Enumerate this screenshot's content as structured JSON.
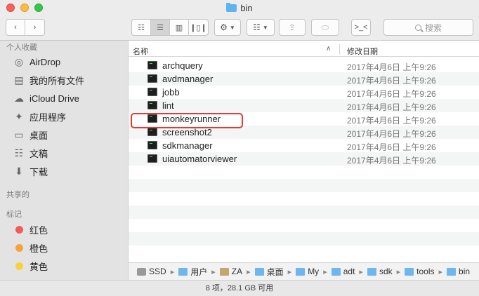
{
  "window": {
    "title": "bin"
  },
  "toolbar": {
    "back_icon": "chevron-left",
    "forward_icon": "chevron-right",
    "terminal_label": ">_<",
    "search_placeholder": "搜索"
  },
  "sidebar": {
    "favorites_header": "个人收藏",
    "favorites": [
      {
        "label": "AirDrop",
        "icon": "airdrop-icon"
      },
      {
        "label": "我的所有文件",
        "icon": "all-files-icon"
      },
      {
        "label": "iCloud Drive",
        "icon": "cloud-icon"
      },
      {
        "label": "应用程序",
        "icon": "applications-icon"
      },
      {
        "label": "桌面",
        "icon": "desktop-icon"
      },
      {
        "label": "文稿",
        "icon": "documents-icon"
      },
      {
        "label": "下载",
        "icon": "downloads-icon"
      }
    ],
    "shared_header": "共享的",
    "tags_header": "标记",
    "tags": [
      {
        "label": "红色",
        "color": "#f25c57"
      },
      {
        "label": "橙色",
        "color": "#f7a33b"
      },
      {
        "label": "黄色",
        "color": "#f7d23e"
      }
    ]
  },
  "columns": {
    "name": "名称",
    "date": "修改日期"
  },
  "files": [
    {
      "name": "archquery",
      "date": "2017年4月6日 上午9:26"
    },
    {
      "name": "avdmanager",
      "date": "2017年4月6日 上午9:26"
    },
    {
      "name": "jobb",
      "date": "2017年4月6日 上午9:26"
    },
    {
      "name": "lint",
      "date": "2017年4月6日 上午9:26"
    },
    {
      "name": "monkeyrunner",
      "date": "2017年4月6日 上午9:26"
    },
    {
      "name": "screenshot2",
      "date": "2017年4月6日 上午9:26"
    },
    {
      "name": "sdkmanager",
      "date": "2017年4月6日 上午9:26"
    },
    {
      "name": "uiautomatorviewer",
      "date": "2017年4月6日 上午9:26"
    }
  ],
  "pathbar": [
    {
      "label": "SSD",
      "icon": "disk"
    },
    {
      "label": "用户",
      "icon": "folder"
    },
    {
      "label": "ZA",
      "icon": "home"
    },
    {
      "label": "桌面",
      "icon": "folder"
    },
    {
      "label": "My",
      "icon": "folder"
    },
    {
      "label": "adt",
      "icon": "folder"
    },
    {
      "label": "sdk",
      "icon": "folder"
    },
    {
      "label": "tools",
      "icon": "folder"
    },
    {
      "label": "bin",
      "icon": "folder"
    }
  ],
  "status": {
    "text": "8 项，28.1 GB 可用"
  }
}
